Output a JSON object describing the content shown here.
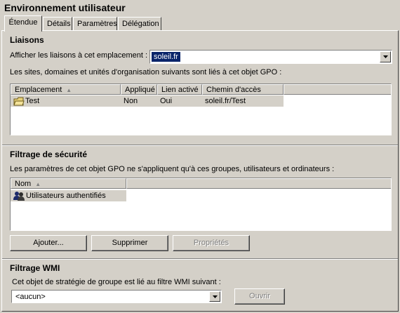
{
  "page": {
    "title": "Environnement utilisateur"
  },
  "tabs": [
    {
      "label": "Étendue",
      "active": true
    },
    {
      "label": "Détails",
      "active": false
    },
    {
      "label": "Paramètres",
      "active": false
    },
    {
      "label": "Délégation",
      "active": false
    }
  ],
  "liaisons": {
    "title": "Liaisons",
    "show_label": "Afficher les liaisons à cet emplacement :",
    "location_value": "soleil.fr",
    "description": "Les sites, domaines et unités d'organisation suivants sont liés à cet objet GPO :",
    "columns": [
      "Emplacement",
      "Appliqué",
      "Lien activé",
      "Chemin d'accès"
    ],
    "rows": [
      {
        "location": "Test",
        "applied": "Non",
        "link_enabled": "Oui",
        "path": "soleil.fr/Test"
      }
    ]
  },
  "security": {
    "title": "Filtrage de sécurité",
    "description": "Les paramètres de cet objet GPO ne s'appliquent qu'à ces groupes, utilisateurs et ordinateurs :",
    "columns": [
      "Nom"
    ],
    "rows": [
      {
        "name": "Utilisateurs authentifiés"
      }
    ],
    "add_label": "Ajouter...",
    "remove_label": "Supprimer",
    "properties_label": "Propriétés"
  },
  "wmi": {
    "title": "Filtrage WMI",
    "description": "Cet objet de stratégie de groupe est lié au filtre WMI suivant :",
    "filter_value": "<aucun>",
    "open_label": "Ouvrir"
  },
  "colors": {
    "face": "#d4d0c8",
    "selection": "#0a246a"
  }
}
